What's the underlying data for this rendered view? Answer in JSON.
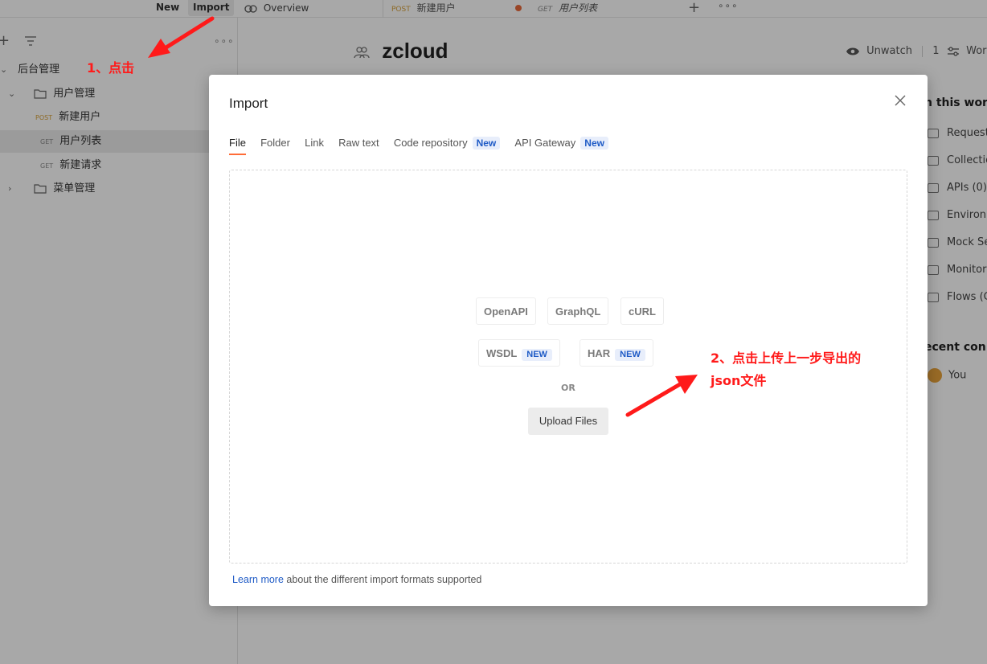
{
  "topbar": {
    "new_label": "New",
    "import_label": "Import",
    "tabs": [
      {
        "label": "Overview"
      },
      {
        "method": "POST",
        "label": "新建用户"
      },
      {
        "method": "GET",
        "label": "用户列表"
      }
    ],
    "more": "∘∘∘",
    "plus": "+"
  },
  "sidebar": {
    "plus": "+",
    "more": "∘∘∘",
    "tree": [
      {
        "label": "后台管理",
        "chev": "⌄"
      },
      {
        "label": "用户管理",
        "chev": "⌄"
      },
      {
        "method": "POST",
        "label": "新建用户"
      },
      {
        "method": "GET",
        "label": "用户列表"
      },
      {
        "method": "GET",
        "label": "新建请求"
      },
      {
        "label": "菜单管理",
        "chev": "›"
      }
    ]
  },
  "workspace": {
    "title": "zcloud",
    "unwatch_label": "Unwatch",
    "watch_count": "1",
    "work_label": "Work",
    "panel_title": "n this work",
    "panel_items": [
      "Request",
      "Collectio",
      "APIs (0)",
      "Environ",
      "Mock Se",
      "Monitor",
      "Flows (C"
    ],
    "recent_title": "ecent con",
    "recent_user": "You"
  },
  "modal": {
    "title": "Import",
    "tabs": [
      {
        "label": "File"
      },
      {
        "label": "Folder"
      },
      {
        "label": "Link"
      },
      {
        "label": "Raw text"
      },
      {
        "label": "Code repository",
        "badge": "New"
      },
      {
        "label": "API Gateway",
        "badge": "New"
      }
    ],
    "formats": {
      "openapi": "OpenAPI",
      "graphql": "GraphQL",
      "curl": "cURL",
      "wsdl": "WSDL",
      "har": "HAR",
      "new_badge": "NEW"
    },
    "or_label": "OR",
    "upload_label": "Upload Files",
    "learn_link": "Learn more",
    "learn_text": " about the different import formats supported"
  },
  "annotations": {
    "step1": "1、点击",
    "step2_line1": "2、点击上传上一步导出的",
    "step2_line2": "json文件"
  },
  "colors": {
    "accent": "#ff6c37",
    "badge_text": "#1f5bc6",
    "annotation": "#ff1a1a"
  }
}
